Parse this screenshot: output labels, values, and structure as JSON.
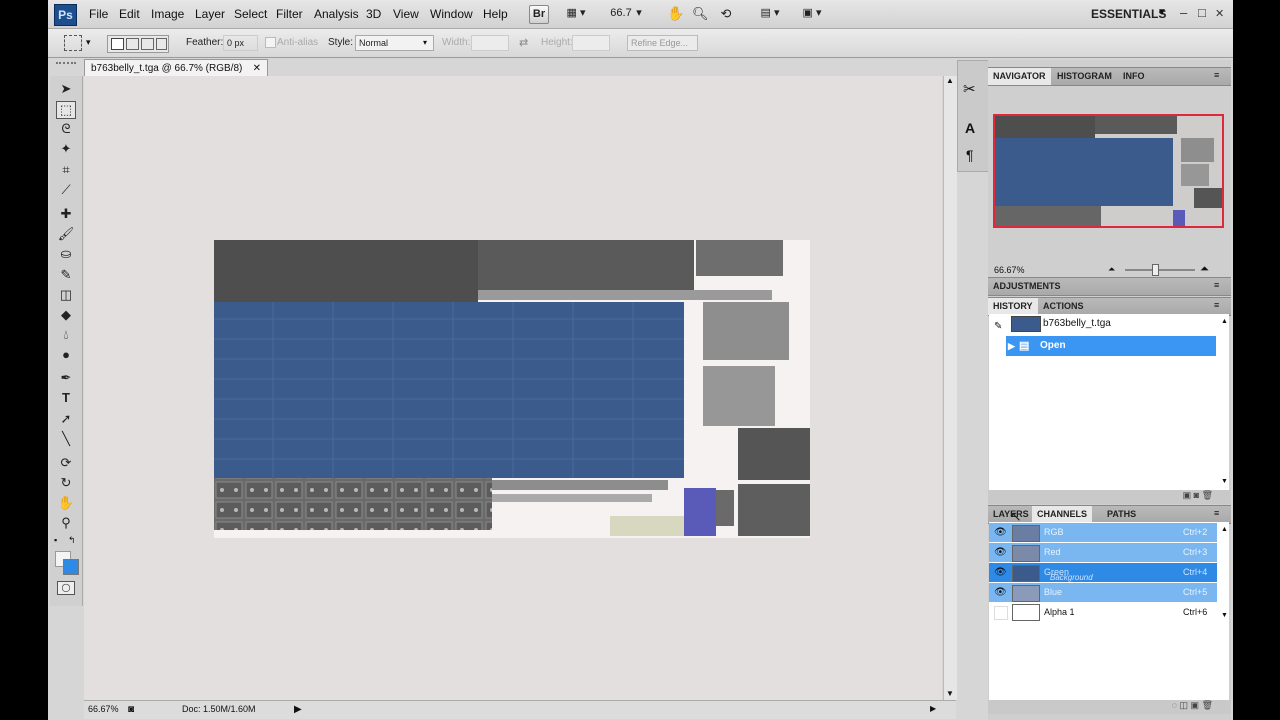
{
  "app": {
    "logo": "Ps",
    "workspace": "ESSENTIALS"
  },
  "menu": [
    "File",
    "Edit",
    "Image",
    "Layer",
    "Select",
    "Filter",
    "Analysis",
    "3D",
    "View",
    "Window",
    "Help"
  ],
  "toolbar": {
    "bridge_label": "Br",
    "zoom_value": "66.7"
  },
  "window_controls": {
    "minimize": "–",
    "restore": "□",
    "close": "✕"
  },
  "options": {
    "feather_label": "Feather:",
    "feather_value": "0 px",
    "antialias_label": "Anti-alias",
    "style_label": "Style:",
    "style_value": "Normal",
    "width_label": "Width:",
    "height_label": "Height:",
    "refine_label": "Refine Edge..."
  },
  "document": {
    "tab_title": "b763belly_t.tga @ 66.7% (RGB/8)",
    "close_glyph": "✕"
  },
  "status": {
    "zoom": "66.67%",
    "doc": "Doc: 1.50M/1.60M"
  },
  "navigator": {
    "tabs": [
      "NAVIGATOR",
      "HISTOGRAM",
      "INFO"
    ],
    "zoom": "66.67%"
  },
  "adjustments": {
    "title": "ADJUSTMENTS"
  },
  "history": {
    "tabs": [
      "HISTORY",
      "ACTIONS"
    ],
    "snapshot": "b763belly_t.tga",
    "items": [
      "Open"
    ]
  },
  "channels": {
    "tabs": [
      "LAYERS",
      "CHANNELS",
      "PATHS"
    ],
    "rows": [
      {
        "name": "RGB",
        "shortcut": "Ctrl+2"
      },
      {
        "name": "Red",
        "shortcut": "Ctrl+3"
      },
      {
        "name": "Green",
        "shortcut": "Ctrl+4"
      },
      {
        "name": "Blue",
        "shortcut": "Ctrl+5"
      },
      {
        "name": "Alpha 1",
        "shortcut": "Ctrl+6"
      }
    ],
    "drag_ghost": "Background"
  },
  "colors": {
    "selection": "#3a96f2",
    "texture_blue": "#3a5a8c",
    "nav_border": "#e0283c"
  }
}
